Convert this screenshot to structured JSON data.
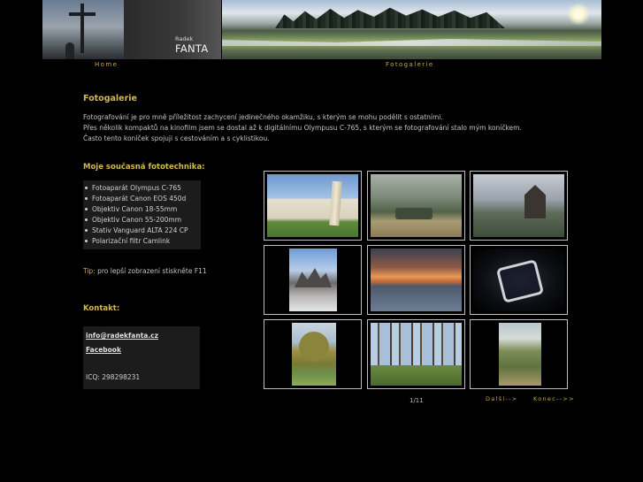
{
  "header": {
    "brand_first": "Radek",
    "brand_last": "FANTA"
  },
  "nav": {
    "home": "Home",
    "gallery": "Fotogalerie"
  },
  "page": {
    "title": "Fotogalerie",
    "intro": [
      "Fotografování je pro mně příležitost zachycení jedinečného okamžiku, s kterým se mohu podělit s ostatními.",
      "Přes několik kompaktů na kinofilm jsem se dostal až k digitálnímu Olympusu C-765, s kterým se fotografování stalo mým koníčkem.",
      "Často tento koníček spojuji s cestováním a s cyklistikou."
    ]
  },
  "equipment": {
    "heading": "Moje současná fototechnika:",
    "items": [
      "Fotoaparát Olympus C-765",
      "Fotoaparát Canon EOS 450d",
      "Objektiv Canon 18-55mm",
      "Objektiv Canon 55-200mm",
      "Stativ Vanguard ALTA 224 CP",
      "Polarizační filtr Camlink"
    ]
  },
  "tip": {
    "label": "Tip:",
    "text": " pro lepší zobrazení stiskněte F11"
  },
  "contact": {
    "heading": "Kontakt:",
    "email": "info@radekfanta.cz",
    "facebook": "Facebook",
    "icq": "ICQ: 298298231"
  },
  "gallery": {
    "thumbnails": [
      {
        "subject": "leaning-tower-pisa"
      },
      {
        "subject": "tank-in-field"
      },
      {
        "subject": "round-chapel"
      },
      {
        "subject": "mountain-peaks"
      },
      {
        "subject": "sunset-over-sea"
      },
      {
        "subject": "stadium-at-night"
      },
      {
        "subject": "willow-tree-by-river"
      },
      {
        "subject": "dead-forest"
      },
      {
        "subject": "river-valley"
      }
    ],
    "pager": "1/11",
    "next": "Další-->",
    "end": "Konec-->>"
  },
  "colors": {
    "background": "#000000",
    "accent": "#d2b855",
    "text": "#c4c4c4",
    "box": "#1c1c1c",
    "frame": "#bfbfbf"
  }
}
